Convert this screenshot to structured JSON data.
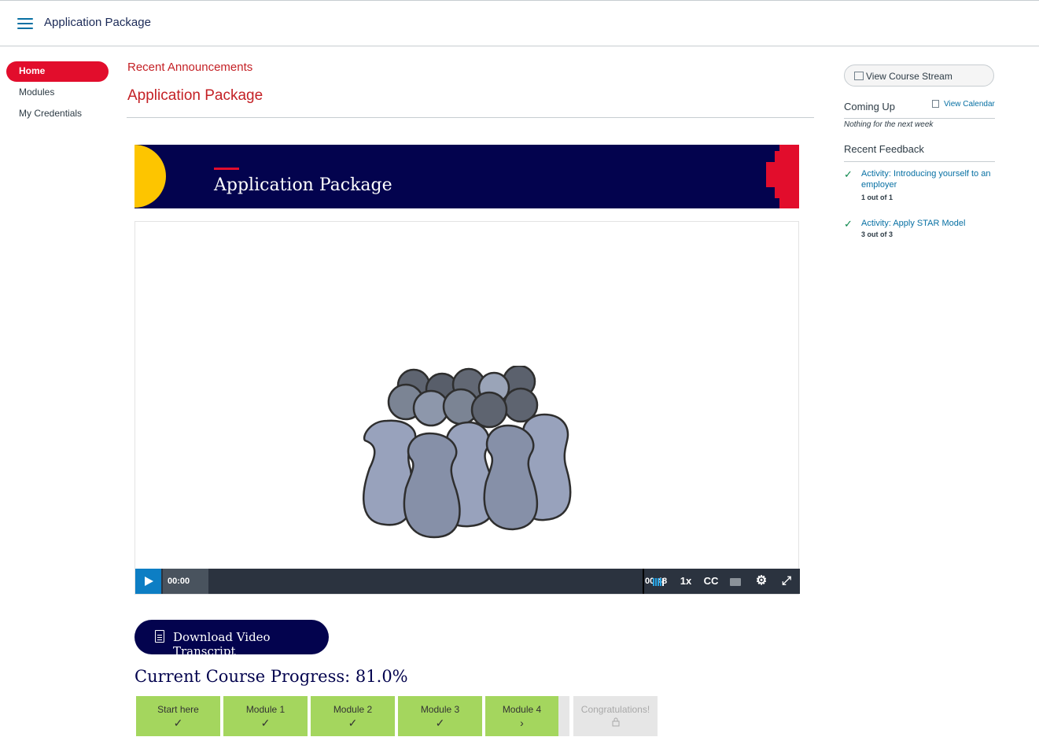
{
  "header": {
    "title": "Application Package"
  },
  "nav": {
    "items": [
      {
        "label": "Home",
        "active": true
      },
      {
        "label": "Modules"
      },
      {
        "label": "My Credentials"
      }
    ]
  },
  "main": {
    "recent_announcements": "Recent Announcements",
    "page_heading": "Application Package",
    "banner_title": "Application Package",
    "video": {
      "current_time": "00:00",
      "duration": "00:48",
      "speed": "1x",
      "cc": "CC",
      "played_fraction": 0.0
    },
    "download_label": "Download Video Transcript",
    "progress": {
      "title": "Current Course Progress: 81.0%",
      "percent": 81.0,
      "steps": [
        {
          "label": "Start here",
          "status": "complete"
        },
        {
          "label": "Module 1",
          "status": "complete"
        },
        {
          "label": "Module 2",
          "status": "complete"
        },
        {
          "label": "Module 3",
          "status": "complete"
        },
        {
          "label": "Module 4",
          "status": "current"
        },
        {
          "label": "Congratulations!",
          "status": "locked"
        }
      ]
    }
  },
  "sidebar_right": {
    "stream_button": "View Course Stream",
    "coming_up": "Coming Up",
    "view_calendar": "View Calendar",
    "nothing_text": "Nothing for the next week",
    "recent_feedback": "Recent Feedback",
    "feedback": [
      {
        "title": "Activity: Introducing yourself to an employer",
        "score": "1 out of 1"
      },
      {
        "title": "Activity: Apply STAR Model",
        "score": "3 out of 3"
      }
    ]
  },
  "colors": {
    "brand_navy": "#03034e",
    "brand_red": "#e20d2c",
    "accent_yellow": "#fdc500",
    "progress_green": "#a4d65e",
    "link_blue": "#0770a3"
  },
  "icons": {
    "menu": "hamburger-icon",
    "play": "play-icon",
    "volume": "volume-icon",
    "caption_settings": "chat-icon",
    "settings": "gear-icon",
    "fullscreen": "expand-icon",
    "document": "document-icon",
    "check": "check-icon",
    "chevron": "chevron-right-icon",
    "lock": "lock-icon",
    "calendar": "calendar-icon",
    "stream": "chart-icon"
  }
}
